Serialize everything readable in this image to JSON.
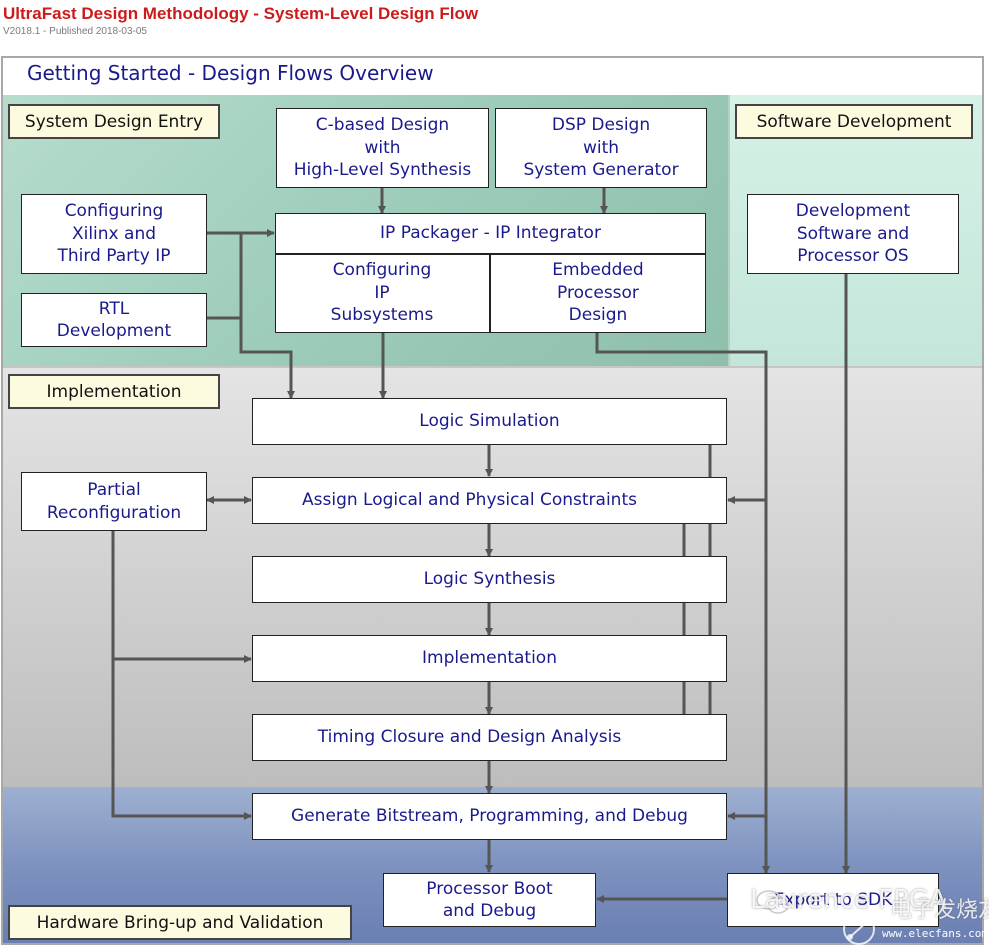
{
  "document": {
    "title": "UltraFast Design Methodology - System-Level Design Flow",
    "subtitle": "V2018.1 - Published 2018-03-05"
  },
  "header": {
    "title": "Getting Started - Design Flows Overview"
  },
  "colors": {
    "title_red": "#cc1b1b",
    "box_text": "#1a1a8c",
    "label_bg": "#fdfbdf",
    "system_section": "#a6d2c0",
    "software_section": "#cdebdf",
    "implementation_section": "#d4d4d4",
    "hardware_section": "#7f93c0",
    "connector": "#555555"
  },
  "sections": {
    "system": {
      "label": "System Design Entry"
    },
    "software": {
      "label": "Software Development"
    },
    "implementation": {
      "label": "Implementation"
    },
    "hardware": {
      "label": "Hardware Bring-up and Validation"
    }
  },
  "nodes": {
    "c_based": {
      "lines": [
        "C-based Design",
        "with",
        "High-Level Synthesis"
      ]
    },
    "dsp": {
      "lines": [
        "DSP Design",
        "with",
        "System Generator"
      ]
    },
    "config_ip": {
      "lines": [
        "Configuring",
        "Xilinx and",
        "Third Party IP"
      ]
    },
    "rtl": {
      "lines": [
        "RTL",
        "Development"
      ]
    },
    "ip_packager": {
      "lines": [
        "IP Packager - IP Integrator"
      ]
    },
    "ip_subsystems": {
      "lines": [
        "Configuring",
        "IP",
        "Subsystems"
      ]
    },
    "embedded": {
      "lines": [
        "Embedded",
        "Processor",
        "Design"
      ]
    },
    "dev_software": {
      "lines": [
        "Development",
        "Software and",
        "Processor OS"
      ]
    },
    "logic_sim": {
      "lines": [
        "Logic Simulation"
      ]
    },
    "partial_reconfig": {
      "lines": [
        "Partial",
        "Reconfiguration"
      ]
    },
    "constraints": {
      "lines": [
        "Assign Logical and Physical Constraints"
      ]
    },
    "logic_synth": {
      "lines": [
        "Logic Synthesis"
      ]
    },
    "implementation": {
      "lines": [
        "Implementation"
      ]
    },
    "timing": {
      "lines": [
        "Timing Closure and Design Analysis"
      ]
    },
    "bitstream": {
      "lines": [
        "Generate Bitstream, Programming, and Debug"
      ]
    },
    "processor_boot": {
      "lines": [
        "Processor Boot",
        "and Debug"
      ]
    },
    "export_sdk": {
      "lines": [
        "Export to SDK"
      ]
    }
  },
  "watermark": {
    "text": "Laurence FPGA",
    "site_cn": "电子发烧友",
    "url": "www.elecfans.com"
  }
}
